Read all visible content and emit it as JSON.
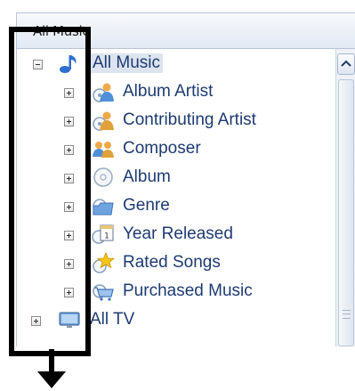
{
  "header": {
    "title": "All Music"
  },
  "tree": {
    "root": {
      "label": "All Music",
      "expanded": true,
      "selected": true,
      "icon": "music-note-icon"
    },
    "children": [
      {
        "label": "Album Artist",
        "icon": "album-artist-icon"
      },
      {
        "label": "Contributing Artist",
        "icon": "contributing-artist-icon"
      },
      {
        "label": "Composer",
        "icon": "composer-icon"
      },
      {
        "label": "Album",
        "icon": "album-disc-icon"
      },
      {
        "label": "Genre",
        "icon": "genre-folder-icon"
      },
      {
        "label": "Year Released",
        "icon": "calendar-icon",
        "badge": "1"
      },
      {
        "label": "Rated Songs",
        "icon": "star-icon"
      },
      {
        "label": "Purchased Music",
        "icon": "shopping-cart-icon"
      }
    ],
    "sibling": {
      "label": "All TV",
      "expanded": false,
      "icon": "monitor-icon"
    }
  },
  "annotation": {
    "box_color": "#000000",
    "arrow_direction": "down"
  },
  "colors": {
    "label_text": "#1d3b71",
    "selected_bg": "#dce4ef",
    "border": "#b7c4d6"
  }
}
